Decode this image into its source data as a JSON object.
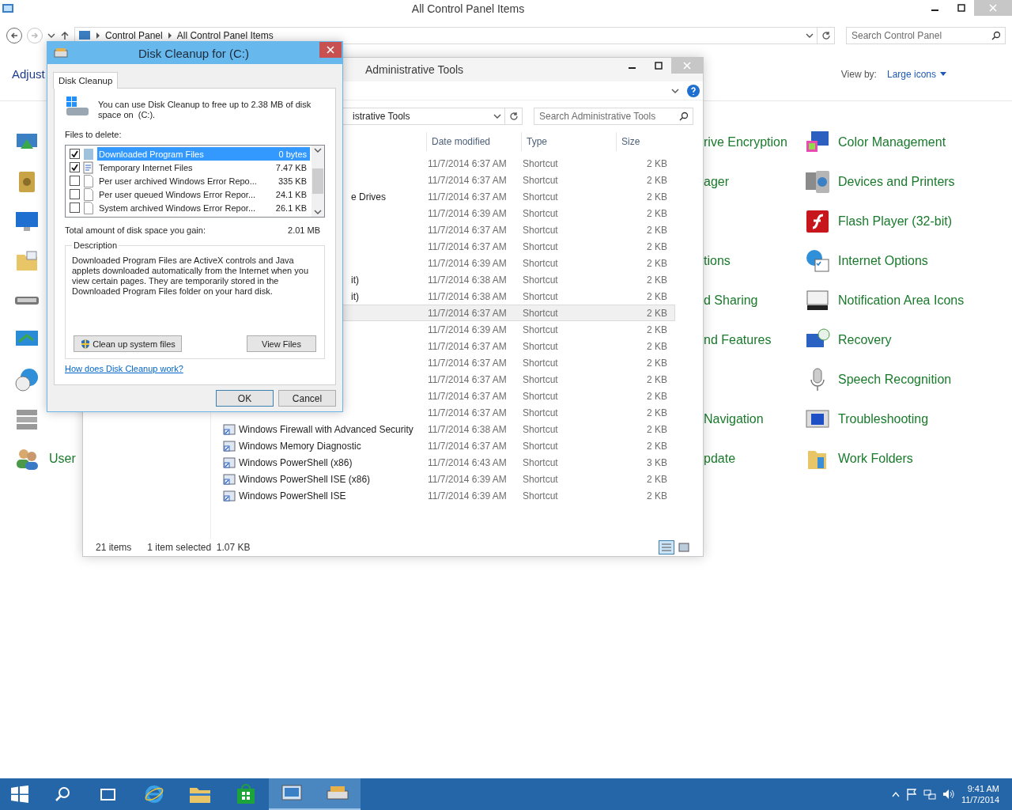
{
  "control_panel": {
    "title": "All Control Panel Items",
    "breadcrumb": [
      "Control Panel",
      "All Control Panel Items"
    ],
    "search": {
      "placeholder": "Search Control Panel"
    },
    "heading": "Adjust",
    "view_by_label": "View by:",
    "view_by_value": "Large icons",
    "rows": [
      {
        "middle": "rive Encryption",
        "right": "Color Management"
      },
      {
        "middle": "ager",
        "right": "Devices and Printers"
      },
      {
        "right": "Flash Player (32-bit)"
      },
      {
        "middle": "tions",
        "right": "Internet Options"
      },
      {
        "middle": "d Sharing",
        "right": "Notification Area Icons"
      },
      {
        "middle": "nd Features",
        "right": "Recovery"
      },
      {
        "right": "Speech Recognition"
      },
      {
        "middle": "Navigation",
        "right": "Troubleshooting"
      },
      {
        "left": "User",
        "middle": "pdate",
        "right": "Work Folders"
      }
    ]
  },
  "admin_tools": {
    "title": "Administrative Tools",
    "address": "istrative Tools",
    "search": {
      "placeholder": "Search Administrative Tools"
    },
    "columns": [
      "Date modified",
      "Type",
      "Size"
    ],
    "rows": [
      {
        "date": "11/7/2014 6:37 AM",
        "type": "Shortcut",
        "size": "2 KB",
        "selected": false
      },
      {
        "date": "11/7/2014 6:37 AM",
        "type": "Shortcut",
        "size": "2 KB",
        "selected": false
      },
      {
        "name": "e Drives",
        "cut": true,
        "date": "11/7/2014 6:37 AM",
        "type": "Shortcut",
        "size": "2 KB",
        "selected": false
      },
      {
        "date": "11/7/2014 6:39 AM",
        "type": "Shortcut",
        "size": "2 KB",
        "selected": false
      },
      {
        "date": "11/7/2014 6:37 AM",
        "type": "Shortcut",
        "size": "2 KB",
        "selected": false
      },
      {
        "date": "11/7/2014 6:37 AM",
        "type": "Shortcut",
        "size": "2 KB",
        "selected": false
      },
      {
        "date": "11/7/2014 6:39 AM",
        "type": "Shortcut",
        "size": "2 KB",
        "selected": false
      },
      {
        "name": "it)",
        "cut": true,
        "date": "11/7/2014 6:38 AM",
        "type": "Shortcut",
        "size": "2 KB",
        "selected": false
      },
      {
        "name": "it)",
        "cut": true,
        "date": "11/7/2014 6:38 AM",
        "type": "Shortcut",
        "size": "2 KB",
        "selected": false
      },
      {
        "date": "11/7/2014 6:37 AM",
        "type": "Shortcut",
        "size": "2 KB",
        "selected": true
      },
      {
        "date": "11/7/2014 6:39 AM",
        "type": "Shortcut",
        "size": "2 KB",
        "selected": false
      },
      {
        "date": "11/7/2014 6:37 AM",
        "type": "Shortcut",
        "size": "2 KB",
        "selected": false
      },
      {
        "date": "11/7/2014 6:37 AM",
        "type": "Shortcut",
        "size": "2 KB",
        "selected": false
      },
      {
        "date": "11/7/2014 6:37 AM",
        "type": "Shortcut",
        "size": "2 KB",
        "selected": false
      },
      {
        "date": "11/7/2014 6:37 AM",
        "type": "Shortcut",
        "size": "2 KB",
        "selected": false
      },
      {
        "date": "11/7/2014 6:37 AM",
        "type": "Shortcut",
        "size": "2 KB",
        "selected": false
      },
      {
        "name": "Windows Firewall with Advanced Security",
        "date": "11/7/2014 6:38 AM",
        "type": "Shortcut",
        "size": "2 KB",
        "selected": false
      },
      {
        "name": "Windows Memory Diagnostic",
        "date": "11/7/2014 6:37 AM",
        "type": "Shortcut",
        "size": "2 KB",
        "selected": false
      },
      {
        "name": "Windows PowerShell (x86)",
        "date": "11/7/2014 6:43 AM",
        "type": "Shortcut",
        "size": "3 KB",
        "selected": false
      },
      {
        "name": "Windows PowerShell ISE (x86)",
        "date": "11/7/2014 6:39 AM",
        "type": "Shortcut",
        "size": "2 KB",
        "selected": false
      },
      {
        "name": "Windows PowerShell ISE",
        "date": "11/7/2014 6:39 AM",
        "type": "Shortcut",
        "size": "2 KB",
        "selected": false
      }
    ],
    "status": {
      "count": "21 items",
      "selection": "1 item selected  1.07 KB"
    }
  },
  "disk_cleanup": {
    "title": "Disk Cleanup for  (C:)",
    "tab": "Disk Cleanup",
    "intro": "You can use Disk Cleanup to free up to 2.38 MB of disk space on  (C:).",
    "files_label": "Files to delete:",
    "files": [
      {
        "name": "Downloaded Program Files",
        "size": "0 bytes",
        "checked": true,
        "selected": true
      },
      {
        "name": "Temporary Internet Files",
        "size": "7.47 KB",
        "checked": true,
        "selected": false
      },
      {
        "name": "Per user archived Windows Error Repo...",
        "size": "335 KB",
        "checked": false,
        "selected": false
      },
      {
        "name": "Per user queued Windows Error Repor...",
        "size": "24.1 KB",
        "checked": false,
        "selected": false
      },
      {
        "name": "System archived Windows Error Repor...",
        "size": "26.1 KB",
        "checked": false,
        "selected": false
      }
    ],
    "total_label": "Total amount of disk space you gain:",
    "total_value": "2.01 MB",
    "description_label": "Description",
    "description": "Downloaded Program Files are ActiveX controls and Java applets downloaded automatically from the Internet when you view certain pages. They are temporarily stored in the Downloaded Program Files folder on your hard disk.",
    "clean_button": "Clean up system files",
    "view_button": "View Files",
    "help_link": "How does Disk Cleanup work?",
    "ok": "OK",
    "cancel": "Cancel"
  },
  "taskbar": {
    "apps": [
      {
        "active": false
      },
      {
        "active": false
      },
      {
        "active": false
      },
      {
        "active": false
      },
      {
        "active": true
      },
      {
        "active": true
      }
    ],
    "time": "9:41 AM",
    "date": "11/7/2014"
  }
}
